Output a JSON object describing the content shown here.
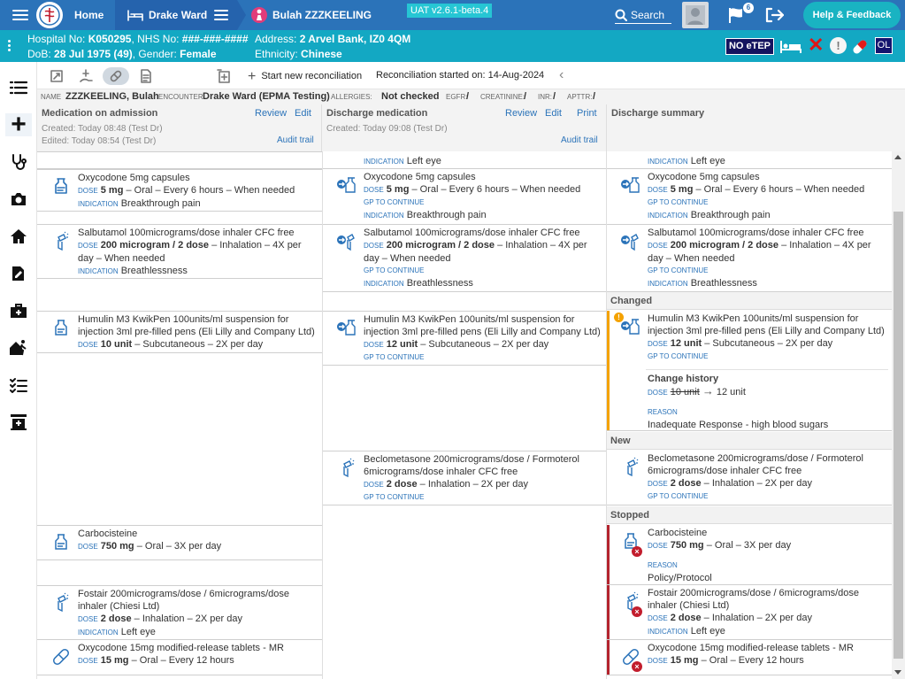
{
  "topbar": {
    "home": "Home",
    "ward": "Drake Ward",
    "patient": "Bulah ZZZKEELING",
    "version": "UAT v2.6.1-beta.4",
    "search": "Search",
    "notifications": "6",
    "feedback": "Help & Feedback",
    "colors": {
      "bar": "#2b73b9",
      "feedback": "#19b3c2"
    }
  },
  "banner": {
    "hospital_label": "Hospital No:",
    "hospital_no": "K050295",
    "nhs_label": ", NHS No:",
    "nhs_no": "###-###-####",
    "dob_label": "DoB:",
    "dob": "28 Jul 1975 (49)",
    "gender_label": ", Gender:",
    "gender": "Female",
    "address_label": "Address:",
    "address": "2 Arvel Bank, IZ0 4QM",
    "ethnicity_label": "Ethnicity:",
    "ethnicity": "Chinese",
    "no_etep": "NO eTEP",
    "ol": "OL",
    "alert": "!",
    "color": "#13a8c3"
  },
  "toolbar": {
    "new_reconciliation": "Start new reconciliation",
    "started": "Reconciliation started on: 14-Aug-2024"
  },
  "info": {
    "name_label": "NAME",
    "name": "ZZZKEELING, Bulah",
    "encounter_label": "ENCOUNTER",
    "encounter": "Drake Ward (EPMA Testing)",
    "allergies_label": "ALLERGIES:",
    "allergies": "Not checked",
    "egfr_label": "EGFR:",
    "egfr": "/",
    "creatinine_label": "CREATININE:",
    "creatinine": "/",
    "inr_label": "INR:",
    "inr": "/",
    "aptt_label": "APTTR:",
    "aptt": "/"
  },
  "columns": {
    "admission": {
      "title": "Medication on admission",
      "review": "Review",
      "edit": "Edit",
      "created": "Created: Today 08:48 (Test Dr)",
      "edited": "Edited: Today 08:54 (Test Dr)",
      "audit": "Audit trail"
    },
    "discharge": {
      "title": "Discharge medication",
      "review": "Review",
      "edit": "Edit",
      "print": "Print",
      "created": "Created: Today 09:08 (Test Dr)",
      "audit": "Audit trail"
    },
    "summary": {
      "title": "Discharge summary"
    }
  },
  "labels": {
    "dose": "DOSE",
    "indication": "INDICATION",
    "gp": "GP TO CONTINUE",
    "reason": "REASON",
    "arrow": "→"
  },
  "sections": {
    "changed": "Changed",
    "new": "New",
    "stopped": "Stopped"
  },
  "meds": {
    "top_indication": "Left eye",
    "oxy5": {
      "name": "Oxycodone 5mg capsules",
      "strength": "5 mg",
      "rest": " – Oral – Every 6 hours – When needed",
      "indication": "Breakthrough pain"
    },
    "salb": {
      "name": "Salbutamol 100micrograms/dose inhaler CFC free",
      "strength": "200 microgram / 2 dose",
      "rest": " – Inhalation – 4X per day – When needed",
      "indication": "Breathlessness"
    },
    "humulin": {
      "name": "Humulin M3 KwikPen 100units/ml suspension for injection 3ml pre-filled pens (Eli Lilly and Company Ltd)",
      "strength_adm": "10 unit",
      "strength_dis": "12 unit",
      "rest": " – Subcutaneous – 2X per day"
    },
    "change": {
      "title": "Change history",
      "old": "10 unit",
      "new": "12 unit",
      "reason": "Inadequate Response - high blood sugars"
    },
    "beclo": {
      "name": "Beclometasone 200micrograms/dose / Formoterol 6micrograms/dose inhaler CFC free",
      "strength": "2 dose",
      "rest": " – Inhalation – 2X per day"
    },
    "carbo": {
      "name": "Carbocisteine",
      "strength": "750 mg",
      "rest": " – Oral – 3X per day",
      "reason": "Policy/Protocol"
    },
    "fostair": {
      "name": "Fostair 200micrograms/dose / 6micrograms/dose inhaler (Chiesi Ltd)",
      "strength": "2 dose",
      "rest": " – Inhalation – 2X per day",
      "indication": "Left eye"
    },
    "oxy15": {
      "name": "Oxycodone 15mg modified-release tablets - MR",
      "strength": "15 mg",
      "rest": " – Oral – Every 12 hours"
    }
  }
}
